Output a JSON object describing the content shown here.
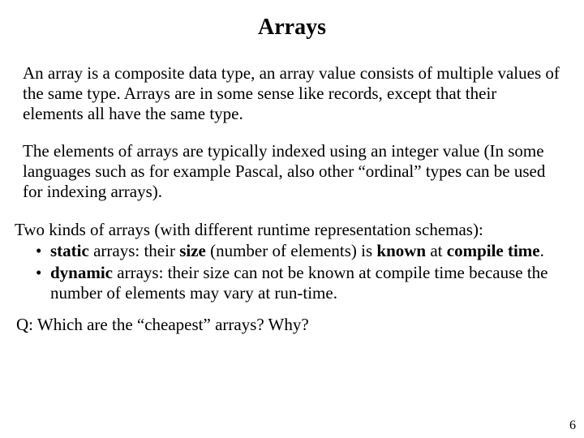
{
  "title": "Arrays",
  "para1": "An array is a composite data type, an array value consists of multiple values of the same type. Arrays are in some sense like records, except that their elements all have the same type.",
  "para2": "The elements of arrays are typically indexed using an integer value (In some languages such as for example Pascal, also other “ordinal” types can be used for indexing arrays).",
  "intro3": "Two kinds of arrays (with different runtime representation schemas):",
  "bullets": [
    {
      "b1": "static",
      "t1": " arrays: their ",
      "b2": "size",
      "t2": " (number of elements) is ",
      "b3": "known",
      "t3": " at ",
      "b4": "compile time",
      "t4": "."
    },
    {
      "b1": "dynamic",
      "t1": " arrays: their size can not be known at compile time because the number of elements may vary at run-time."
    }
  ],
  "question": "Q: Which are the “cheapest” arrays? Why?",
  "pagenum": "6"
}
